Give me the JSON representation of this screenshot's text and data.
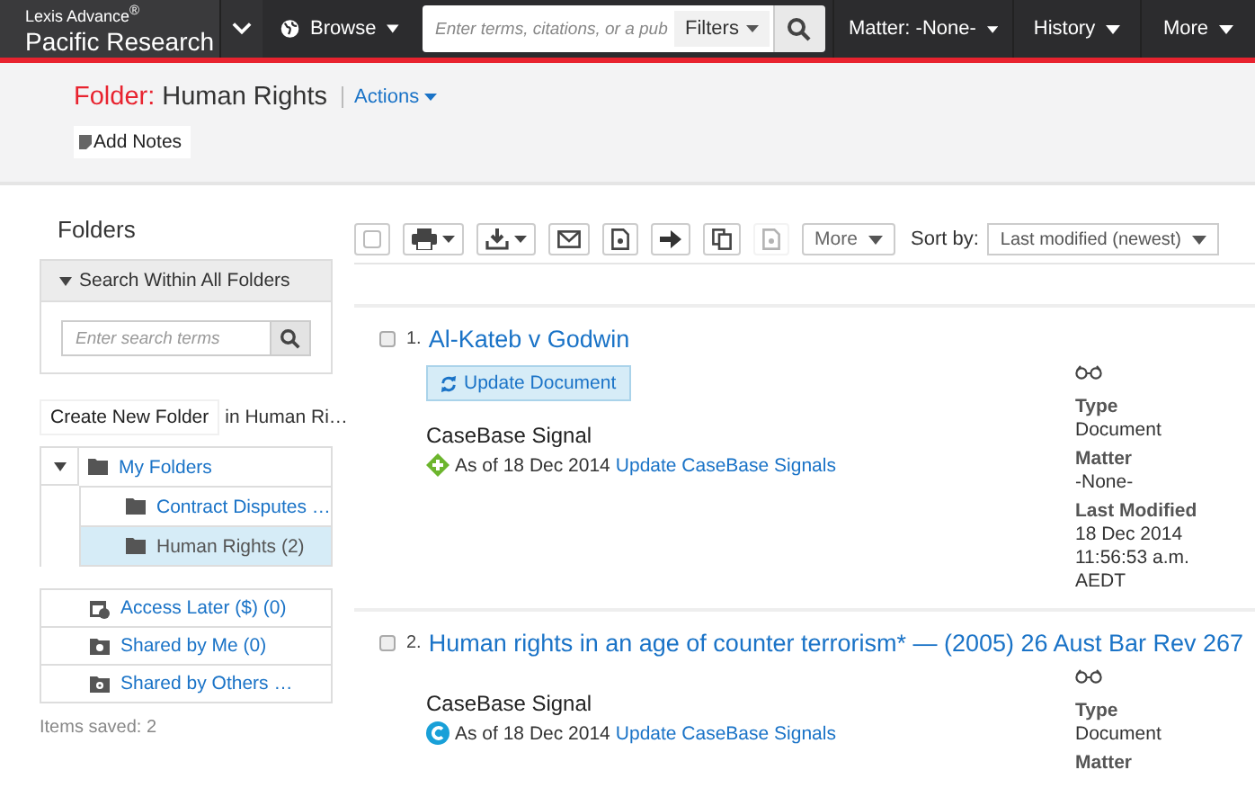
{
  "header": {
    "brand_top": "Lexis Advance$^{®}$",
    "brand": "Pacific Research",
    "browse": "Browse",
    "search": {
      "placeholder": "Enter terms, citations, or a pub"
    },
    "filters": "Filters",
    "matter": "Matter: -None-",
    "history": "History",
    "more": "More"
  },
  "folder_bar": {
    "prefix": "Folder:",
    "name": "Human Rights",
    "actions": "Actions",
    "add_notes": "Add Notes"
  },
  "sidebar": {
    "title": "Folders",
    "search_panel": {
      "title": "Search Within All Folders",
      "expanded": true,
      "placeholder": "Enter search terms"
    },
    "create_button": "Create New Folder",
    "create_target": "in Human Ri…",
    "tree": {
      "label": "My Folders",
      "expanded": true,
      "children": [
        {
          "label": "Contract Disputes …",
          "selected": false
        },
        {
          "label": "Human Rights (2)",
          "selected": true
        }
      ]
    },
    "lists": [
      {
        "kind": "later",
        "label": "Access Later ($) (0)"
      },
      {
        "kind": "shared-me",
        "label": "Shared by Me (0)"
      },
      {
        "kind": "shared-others",
        "label": "Shared by Others …"
      }
    ],
    "items_saved": "Items saved: 2"
  },
  "toolbar": {
    "tools": [
      {
        "kind": "checkbox",
        "checked": false
      },
      {
        "kind": "print",
        "disabled": false
      },
      {
        "kind": "download",
        "disabled": false
      },
      {
        "kind": "email",
        "disabled": false
      },
      {
        "kind": "document",
        "disabled": false
      },
      {
        "kind": "arrow",
        "disabled": false
      },
      {
        "kind": "copy",
        "disabled": false
      },
      {
        "kind": "document",
        "disabled": true
      }
    ],
    "more": "More",
    "sort_label": "Sort by:",
    "sort_value": "Last modified (newest)"
  },
  "results": [
    {
      "number": "1.",
      "title": "Al-Kateb v Godwin",
      "checked": false,
      "update_button": "Update Document",
      "signal_title": "CaseBase Signal",
      "signal": {
        "kind": "positive",
        "date": "As of 18 Dec 2014",
        "link": "Update CaseBase Signals"
      },
      "meta": [
        {
          "label": "Type",
          "lines": [
            "Document"
          ]
        },
        {
          "label": "Matter",
          "lines": [
            "-None-"
          ]
        },
        {
          "label": "Last Modified",
          "lines": [
            "18 Dec 2014",
            "11:56:53 a.m.",
            "AEDT"
          ]
        }
      ]
    },
    {
      "number": "2.",
      "title": "Human rights in an age of counter terrorism* — (2005) 26 Aust Bar Rev 267",
      "checked": false,
      "signal_title": "CaseBase Signal",
      "signal": {
        "kind": "cautionary",
        "date": "As of 18 Dec 2014",
        "link": "Update CaseBase Signals"
      },
      "meta": [
        {
          "label": "Type",
          "lines": [
            "Document"
          ]
        },
        {
          "label": "Matter"
        }
      ]
    }
  ]
}
